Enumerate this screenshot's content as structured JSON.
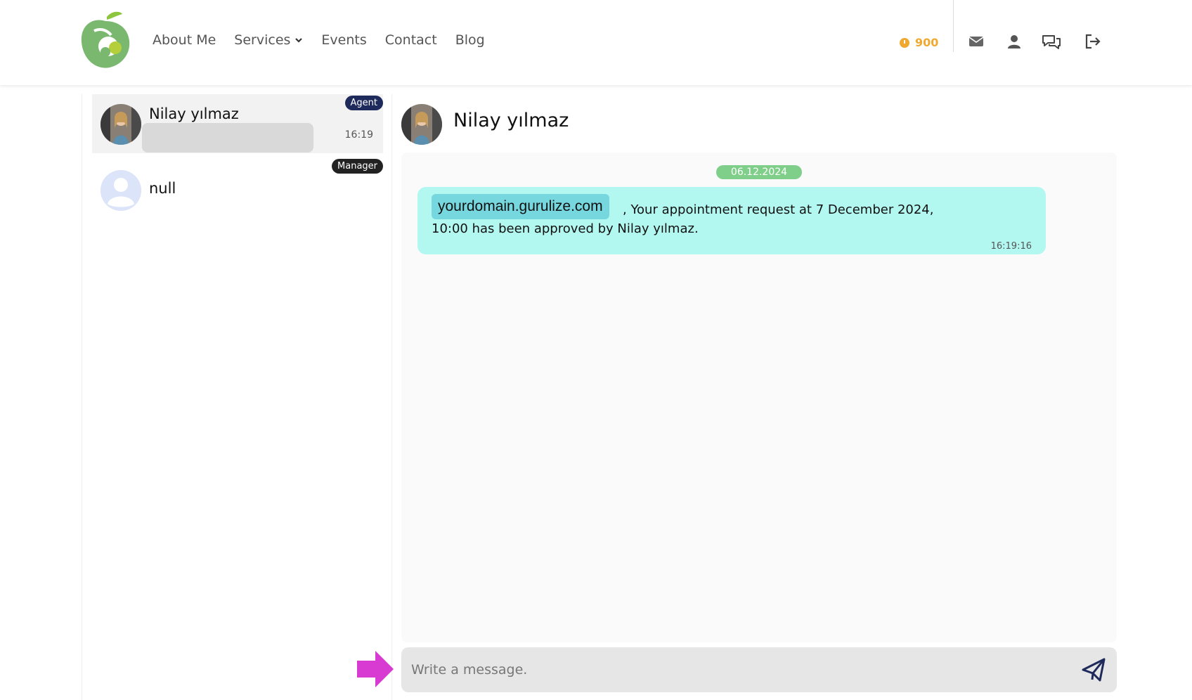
{
  "nav": {
    "items": [
      {
        "label": "About Me"
      },
      {
        "label": "Services"
      },
      {
        "label": "Events"
      },
      {
        "label": "Contact"
      },
      {
        "label": "Blog"
      }
    ],
    "coins": "900",
    "icons": [
      "mail-icon",
      "user-icon",
      "chat-icon",
      "logout-icon"
    ]
  },
  "contacts": [
    {
      "name": "Nilay yılmaz",
      "badge": "Agent",
      "time": "16:19",
      "badge_color": "#1f2a5c"
    },
    {
      "name": "null",
      "badge": "Manager",
      "time": "",
      "badge_color": "#222222"
    }
  ],
  "chat": {
    "title": "Nilay yılmaz",
    "date": "06.12.2024",
    "message": {
      "domain": "yourdomain.gurulize.com",
      "line1": ", Your appointment request at 7 December 2024,",
      "line2": "10:00 has been approved by Nilay yılmaz.",
      "time": "16:19:16"
    }
  },
  "composer": {
    "placeholder": "Write a message."
  },
  "colors": {
    "bubble": "#b3f8f0",
    "date_pill": "#7fcf8a",
    "arrow": "#d83bd2",
    "coins": "#f0a830"
  }
}
